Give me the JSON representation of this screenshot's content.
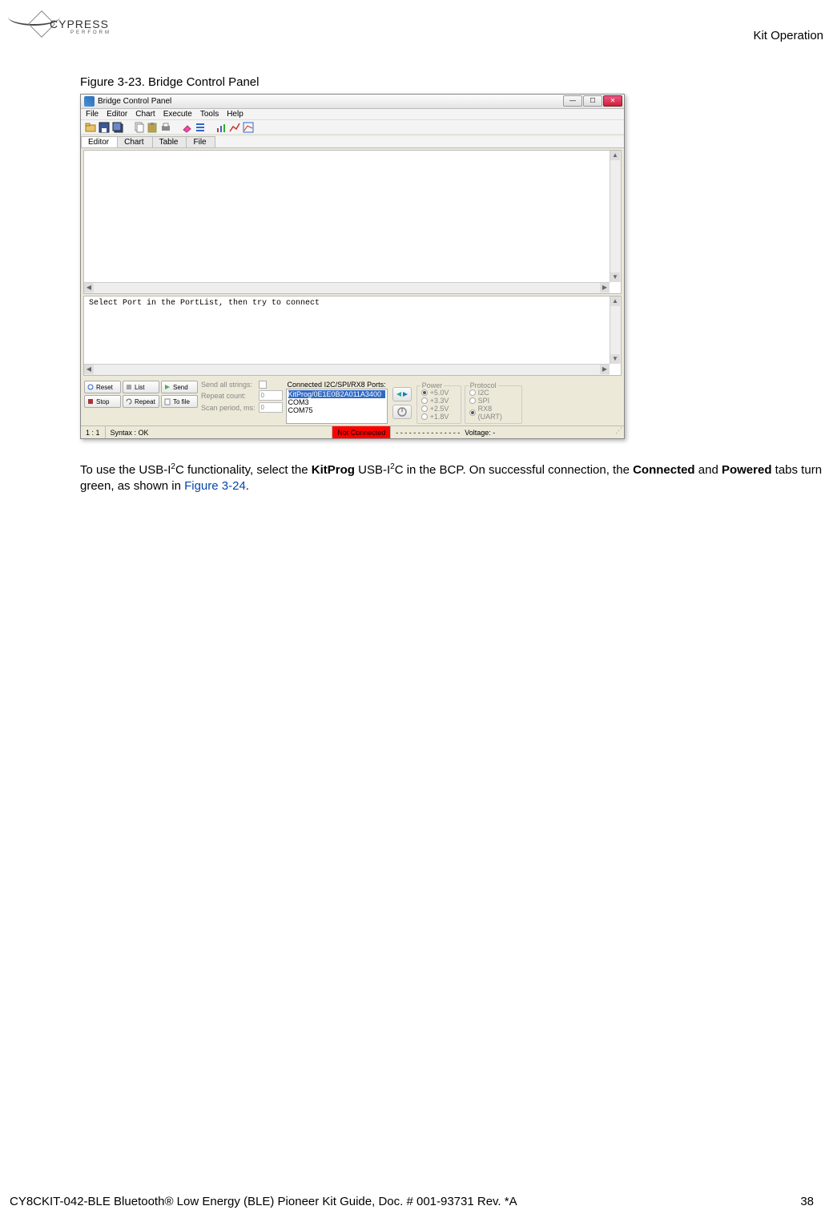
{
  "header": {
    "logo": {
      "name": "CYPRESS",
      "sub": "PERFORM"
    },
    "section": "Kit Operation"
  },
  "figure": {
    "caption": "Figure 3-23.  Bridge Control Panel"
  },
  "app": {
    "title": "Bridge Control Panel",
    "menu": [
      "File",
      "Editor",
      "Chart",
      "Execute",
      "Tools",
      "Help"
    ],
    "tabs": [
      "Editor",
      "Chart",
      "Table",
      "File"
    ],
    "status_prompt": "Select Port in the PortList, then try to connect",
    "buttons": {
      "reset": "Reset",
      "list": "List",
      "send": "Send",
      "stop": "Stop",
      "repeat": "Repeat",
      "tofile": "To file"
    },
    "labels": {
      "send_all": "Send all strings:",
      "repeat_count": "Repeat count:",
      "scan_period": "Scan period, ms:"
    },
    "values": {
      "repeat_count": "0",
      "scan_period": "0"
    },
    "ports": {
      "title": "Connected I2C/SPI/RX8 Ports:",
      "items": [
        "KitProg/0E1E0B2A011A3400",
        "COM3",
        "COM75"
      ]
    },
    "power": {
      "label": "Power",
      "levels": [
        "+5.0V",
        "+3.3V",
        "+2.5V",
        "+1.8V"
      ]
    },
    "protocol": {
      "label": "Protocol",
      "options": [
        "I2C",
        "SPI",
        "RX8 (UART)"
      ]
    },
    "statusbar": {
      "ratio": "1 : 1",
      "syntax": "Syntax : OK",
      "conn": "Not Connected",
      "dots": "- - - - - - - - - - - - - - -",
      "voltage": "Voltage: -"
    }
  },
  "paragraph": {
    "p1a": "To use the USB-I",
    "p1sup": "2",
    "p1b": "C functionality, select the ",
    "p1bold": "KitProg",
    "p1c": " USB-I",
    "p1sup2": "2",
    "p1d": "C in the BCP. On successful connection, the ",
    "p1bold2": "Connected",
    "p1e": " and ",
    "p1bold3": "Powered",
    "p1f": " tabs turn green, as shown in ",
    "p1link": "Figure 3-24",
    "p1g": "."
  },
  "footer": {
    "left": "CY8CKIT-042-BLE Bluetooth® Low Energy (BLE) Pioneer Kit Guide, Doc. # 001-93731 Rev. *A",
    "right": "38"
  }
}
